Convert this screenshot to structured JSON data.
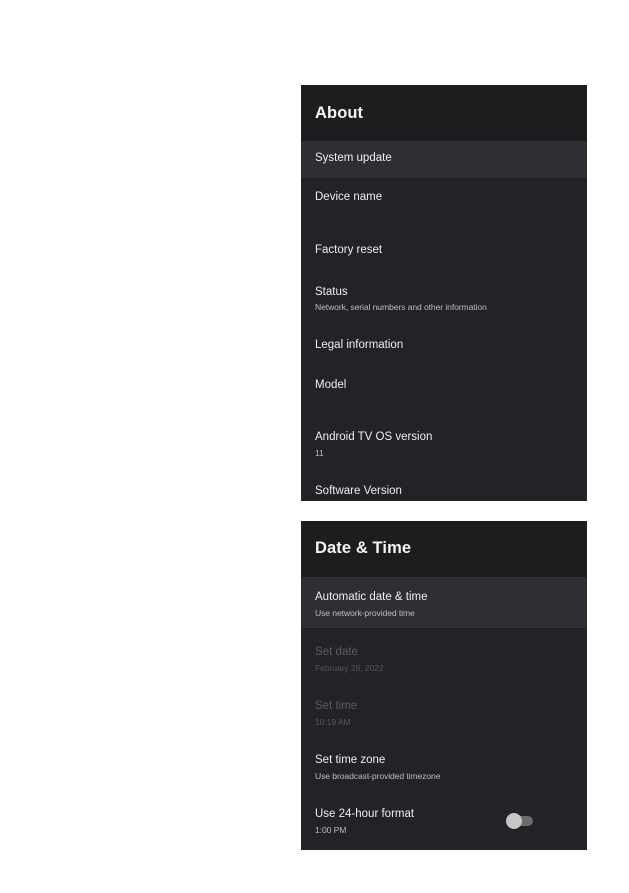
{
  "about": {
    "title": "About",
    "items": [
      {
        "title": "System update",
        "subtitle": null,
        "selected": true
      },
      {
        "title": "Device name",
        "subtitle": null
      },
      {
        "title": "Factory reset",
        "subtitle": null
      },
      {
        "title": "Status",
        "subtitle": "Network, serial numbers and other information"
      },
      {
        "title": "Legal information",
        "subtitle": null
      },
      {
        "title": "Model",
        "subtitle": null
      },
      {
        "title": "Android TV OS version",
        "subtitle": "11"
      },
      {
        "title": "Software Version",
        "subtitle": null
      }
    ]
  },
  "date_time": {
    "title": "Date & Time",
    "items": [
      {
        "title": "Automatic date & time",
        "subtitle": "Use network-provided time",
        "selected": true
      },
      {
        "title": "Set date",
        "subtitle": "February 28, 2022",
        "disabled": true
      },
      {
        "title": "Set time",
        "subtitle": "10:19 AM",
        "disabled": true
      },
      {
        "title": "Set time zone",
        "subtitle": "Use broadcast-provided timezone"
      },
      {
        "title": "Use 24-hour format",
        "subtitle": "1:00 PM",
        "toggle": {
          "state": "off"
        }
      }
    ]
  },
  "colors": {
    "panel_background": "#222327",
    "header_background": "#1c1d1f",
    "selected_row": "#2e2f33",
    "text_primary": "#eeeeee",
    "text_secondary": "#bdbdbd",
    "text_disabled": "#5c5d61",
    "toggle_knob": "#c7c7c7",
    "toggle_track": "#6a6b6e"
  }
}
